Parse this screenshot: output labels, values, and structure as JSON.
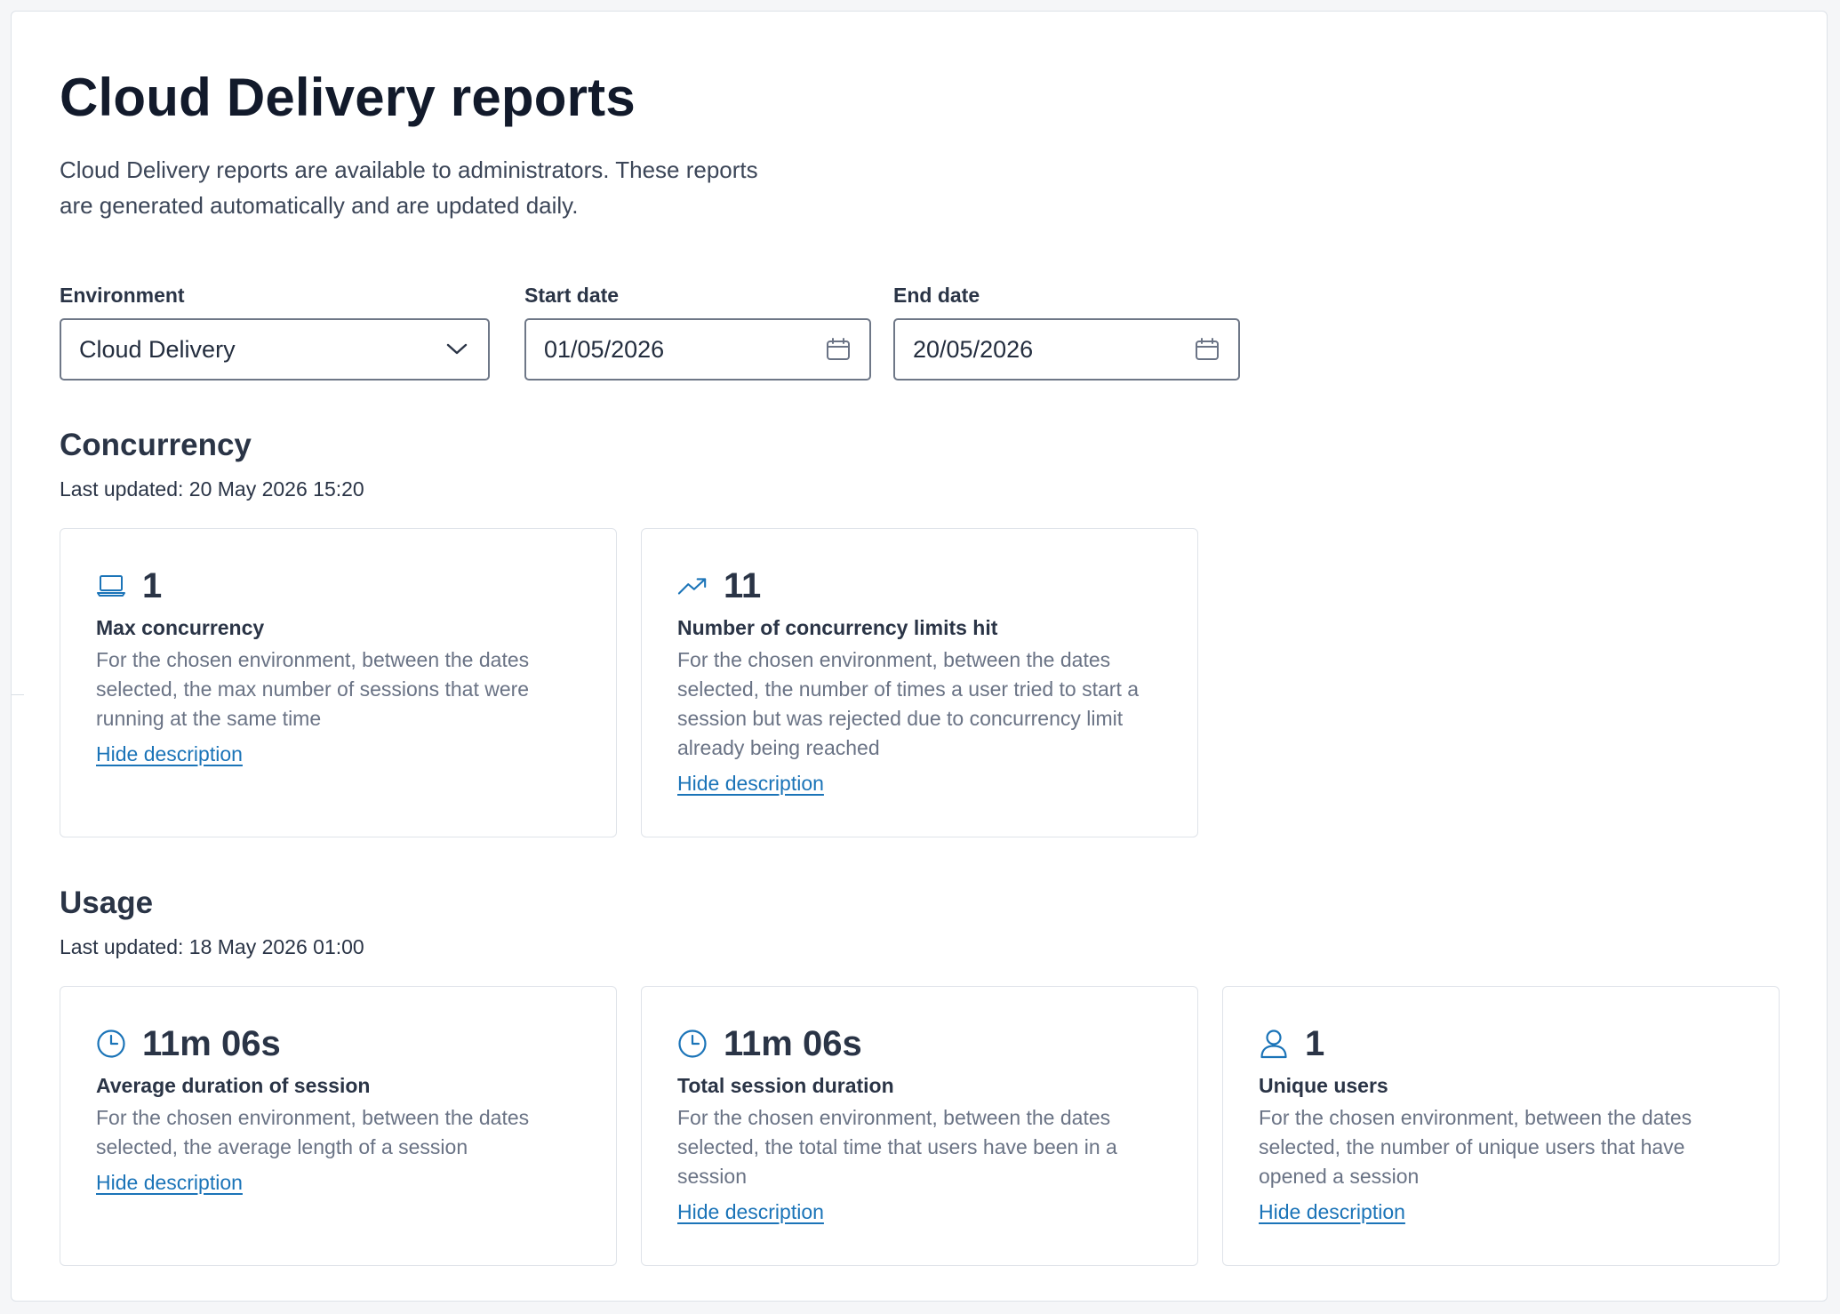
{
  "page": {
    "title": "Cloud Delivery reports",
    "intro": "Cloud Delivery reports are available to administrators. These reports are generated automatically and are updated daily."
  },
  "filters": {
    "environment": {
      "label": "Environment",
      "value": "Cloud Delivery",
      "icon": "chevron-down-icon"
    },
    "start_date": {
      "label": "Start date",
      "value": "01/05/2026",
      "icon": "calendar-icon"
    },
    "end_date": {
      "label": "End date",
      "value": "20/05/2026",
      "icon": "calendar-icon"
    }
  },
  "concurrency": {
    "heading": "Concurrency",
    "updated": "Last updated: 20 May 2026 15:20",
    "cards": [
      {
        "icon": "laptop-icon",
        "value": "1",
        "title": "Max concurrency",
        "description": "For the chosen environment, between the dates selected, the max number of sessions that were running at the same time",
        "link": "Hide description"
      },
      {
        "icon": "trending-up-icon",
        "value": "11",
        "title": "Number of concurrency limits hit",
        "description": "For the chosen environment, between the dates selected, the number of times a user tried to start a session but was rejected due to concurrency limit already being reached",
        "link": "Hide description"
      }
    ]
  },
  "usage": {
    "heading": "Usage",
    "updated": "Last updated: 18 May 2026 01:00",
    "cards": [
      {
        "icon": "clock-icon",
        "value": "11m 06s",
        "title": "Average duration of session",
        "description": "For the chosen environment, between the dates selected, the average length of a session",
        "link": "Hide description"
      },
      {
        "icon": "clock-icon",
        "value": "11m 06s",
        "title": "Total session duration",
        "description": "For the chosen environment, between the dates selected, the total time that users have been in a session",
        "link": "Hide description"
      },
      {
        "icon": "user-icon",
        "value": "1",
        "title": "Unique users",
        "description": "For the chosen environment, between the dates selected, the number of unique users that have opened a session",
        "link": "Hide description"
      }
    ]
  },
  "colors": {
    "accent": "#1b74b8",
    "text": "#2a3446",
    "muted": "#6a7385",
    "border": "#dfe3e9"
  }
}
